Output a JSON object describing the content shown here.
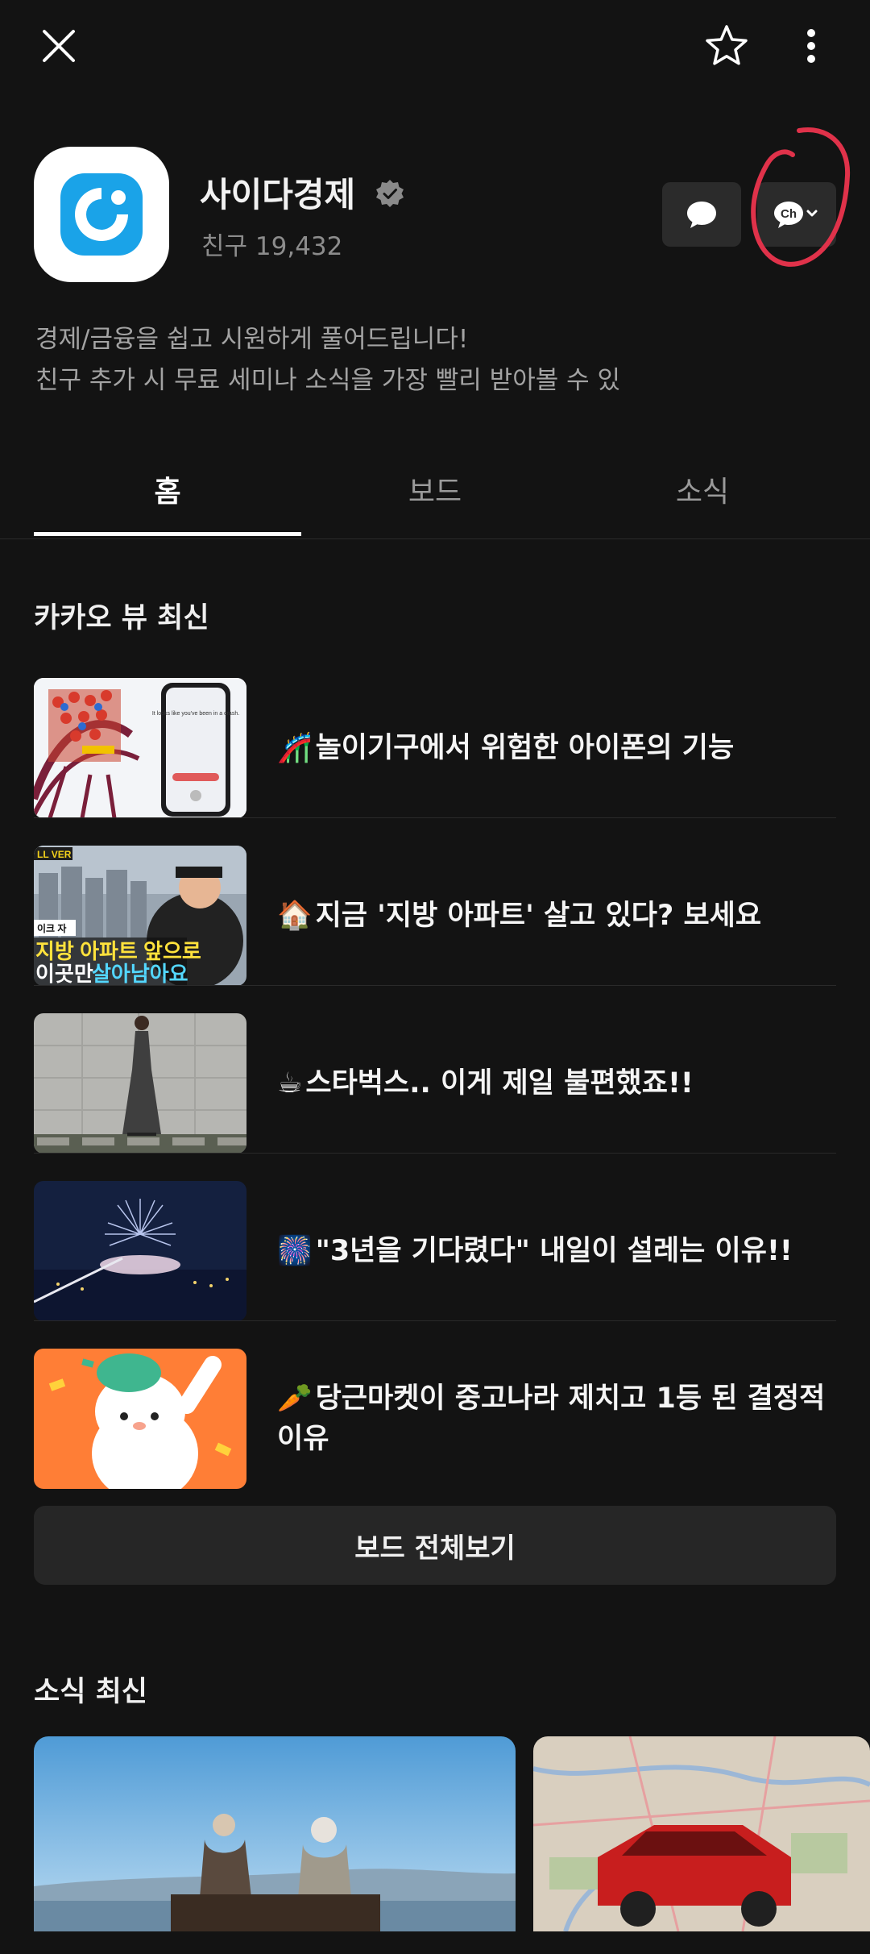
{
  "header": {
    "close_icon": "close-icon",
    "star_icon": "star-icon",
    "more_icon": "more-vertical-icon"
  },
  "profile": {
    "name": "사이다경제",
    "friends": "친구 19,432",
    "chat_icon": "chat-bubble-icon",
    "channel_button_text": "Ch"
  },
  "description": {
    "line1": "경제/금융을 쉽고 시원하게 풀어드립니다!",
    "line2": "친구 추가 시 무료 세미나 소식을 가장 빨리 받아볼 수 있"
  },
  "tabs": [
    {
      "label": "홈",
      "active": true
    },
    {
      "label": "보드",
      "active": false
    },
    {
      "label": "소식",
      "active": false
    }
  ],
  "view_section": {
    "title": "카카오 뷰 최신",
    "items": [
      {
        "emoji": "🎢",
        "title": "놀이기구에서 위험한 아이폰의 기능"
      },
      {
        "emoji": "🏠",
        "title": "지금 '지방 아파트' 살고 있다? 보세요"
      },
      {
        "emoji": "☕",
        "title": "스타벅스.. 이게 제일 불편했죠!!"
      },
      {
        "emoji": "🎆",
        "title": "\"3년을 기다렸다\" 내일이 설레는 이유!!"
      },
      {
        "emoji": "🥕",
        "title": "당근마켓이 중고나라 제치고 1등 된 결정적 이유"
      }
    ],
    "thumb_texts": {
      "phone_text": "It looks like you've been in a crash.",
      "apartment_tag": "LL VER",
      "apartment_small": "이크 자",
      "apartment_line1": "지방 아파트 앞으로",
      "apartment_line2_a": "이곳만",
      "apartment_line2_b": "살아남아요"
    },
    "board_all_button": "보드 전체보기"
  },
  "news_section": {
    "title": "소식 최신"
  }
}
